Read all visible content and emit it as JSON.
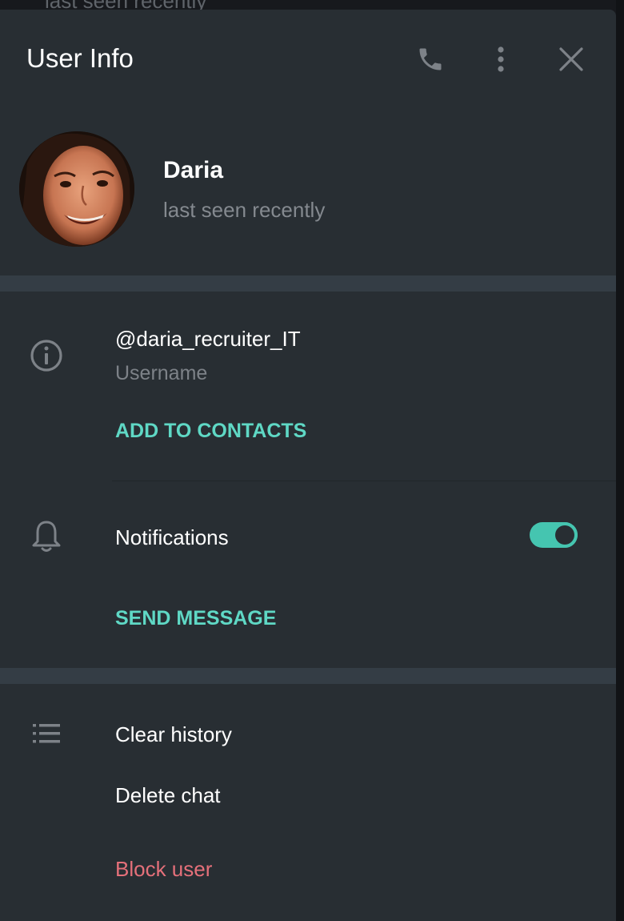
{
  "backdrop": {
    "partial_status_text": "last seen recently"
  },
  "header": {
    "title": "User Info",
    "icons": {
      "call": "phone-icon",
      "more": "more-vertical-icon",
      "close": "close-icon"
    }
  },
  "profile": {
    "name": "Daria",
    "status": "last seen recently",
    "avatar": "avatar-photo"
  },
  "info": {
    "icon": "info-icon",
    "username": "@daria_recruiter_IT",
    "username_label": "Username",
    "add_contact_label": "ADD TO CONTACTS"
  },
  "notifications": {
    "icon": "bell-icon",
    "label": "Notifications",
    "enabled": true,
    "send_message_label": "SEND MESSAGE"
  },
  "actions": {
    "icon": "list-icon",
    "clear_history": "Clear history",
    "delete_chat": "Delete chat",
    "block_user": "Block user"
  },
  "colors": {
    "panel_bg": "#282e33",
    "accent": "#5fd8c5",
    "danger": "#e5707a",
    "secondary_text": "#84898f"
  }
}
